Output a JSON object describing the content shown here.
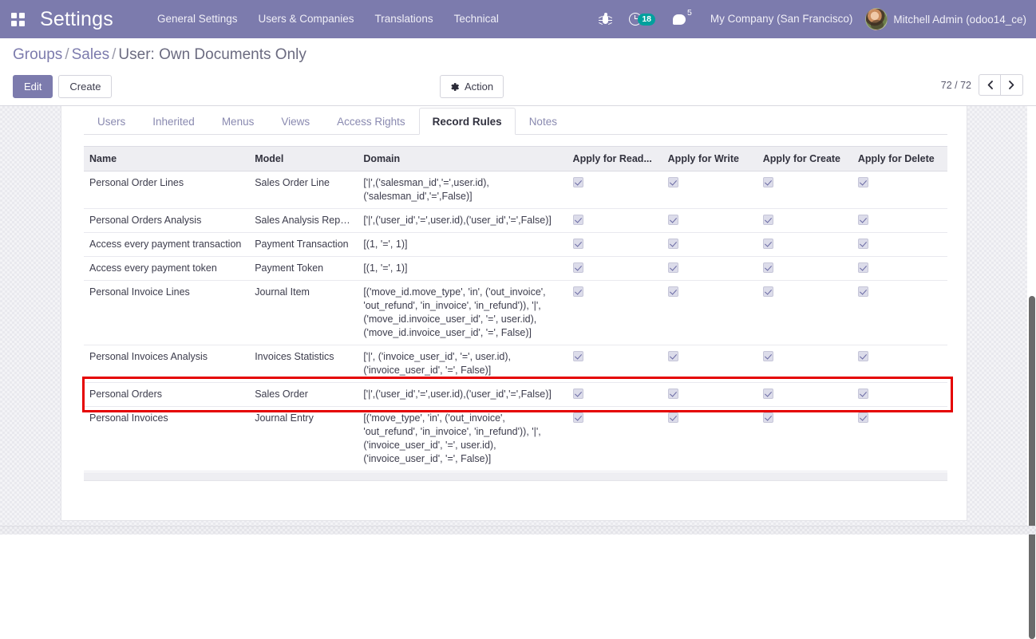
{
  "navbar": {
    "apps_icon": "grid-apps-icon",
    "brand": "Settings",
    "menu_items": [
      {
        "label": "General Settings"
      },
      {
        "label": "Users & Companies"
      },
      {
        "label": "Translations"
      },
      {
        "label": "Technical"
      }
    ],
    "debug_icon": "bug-icon",
    "activity_icon": "clock-icon",
    "activity_count": "18",
    "messaging_icon": "chat-bubble-icon",
    "messaging_count": "5",
    "company": "My Company (San Francisco)",
    "user": "Mitchell Admin (odoo14_ce)",
    "avatar_icon": "user-avatar",
    "accent_color": "#7c7bad",
    "badge_color": "#00a09d"
  },
  "control_panel": {
    "breadcrumb": {
      "root": "Groups",
      "parent": "Sales",
      "current": "User: Own Documents Only",
      "separator": "/"
    },
    "edit_label": "Edit",
    "create_label": "Create",
    "action_label": "Action",
    "action_icon": "gear-icon",
    "pager_text": "72 / 72",
    "pager_prev_icon": "chevron-left-icon",
    "pager_next_icon": "chevron-right-icon"
  },
  "notebook": {
    "tabs": [
      {
        "label": "Users",
        "active": false
      },
      {
        "label": "Inherited",
        "active": false
      },
      {
        "label": "Menus",
        "active": false
      },
      {
        "label": "Views",
        "active": false
      },
      {
        "label": "Access Rights",
        "active": false
      },
      {
        "label": "Record Rules",
        "active": true
      },
      {
        "label": "Notes",
        "active": false
      }
    ]
  },
  "record_rules_table": {
    "columns": [
      "Name",
      "Model",
      "Domain",
      "Apply for Read...",
      "Apply for Write",
      "Apply for Create",
      "Apply for Delete"
    ],
    "rows": [
      {
        "name": "Personal Order Lines",
        "model": "Sales Order Line",
        "domain": "['|',('salesman_id','=',user.id),\n('salesman_id','=',False)]",
        "read": true,
        "write": true,
        "create": true,
        "delete": true
      },
      {
        "name": "Personal Orders Analysis",
        "model": "Sales Analysis Rep…",
        "domain": "['|',('user_id','=',user.id),('user_id','=',False)]",
        "read": true,
        "write": true,
        "create": true,
        "delete": true
      },
      {
        "name": "Access every payment transaction",
        "model": "Payment Transaction",
        "domain": "[(1, '=', 1)]",
        "read": true,
        "write": true,
        "create": true,
        "delete": true
      },
      {
        "name": "Access every payment token",
        "model": "Payment Token",
        "domain": "[(1, '=', 1)]",
        "read": true,
        "write": true,
        "create": true,
        "delete": true
      },
      {
        "name": "Personal Invoice Lines",
        "model": "Journal Item",
        "domain": "[('move_id.move_type', 'in', ('out_invoice',\n'out_refund', 'in_invoice', 'in_refund')), '|',\n('move_id.invoice_user_id', '=', user.id),\n('move_id.invoice_user_id', '=', False)]",
        "read": true,
        "write": true,
        "create": true,
        "delete": true
      },
      {
        "name": "Personal Invoices Analysis",
        "model": "Invoices Statistics",
        "domain": "['|', ('invoice_user_id', '=', user.id),\n('invoice_user_id', '=', False)]",
        "read": true,
        "write": true,
        "create": true,
        "delete": true
      },
      {
        "name": "Personal Orders",
        "model": "Sales Order",
        "domain": "['|',('user_id','=',user.id),('user_id','=',False)]",
        "read": true,
        "write": true,
        "create": true,
        "delete": true,
        "highlighted": true
      },
      {
        "name": "Personal Invoices",
        "model": "Journal Entry",
        "domain": "[('move_type', 'in', ('out_invoice',\n'out_refund', 'in_invoice', 'in_refund')), '|',\n('invoice_user_id', '=', user.id),\n('invoice_user_id', '=', False)]",
        "read": true,
        "write": true,
        "create": true,
        "delete": true
      }
    ],
    "highlight_color": "#e50000"
  }
}
